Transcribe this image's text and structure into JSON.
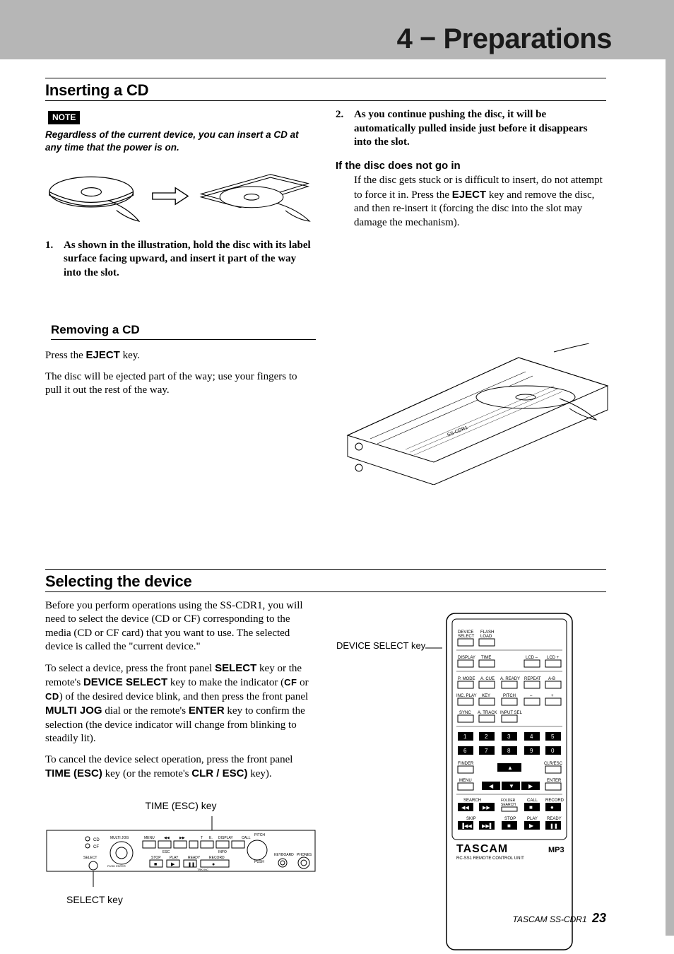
{
  "header": {
    "title": "4 − Preparations"
  },
  "s1": {
    "title": "Inserting a CD",
    "note_label": "NOTE",
    "note_text": "Regardless of the current device, you can insert a CD at any time that the power is on.",
    "steps": [
      "As shown in the illustration, hold the disc with its label surface facing upward, and insert it part of the way into the slot.",
      "As you continue pushing the disc, it will be automatically pulled inside just before it disappears into the slot."
    ],
    "if_title": "If the disc does not go in",
    "if_text_a": "If the disc gets stuck or is difficult to insert, do not attempt to force it in. Press the ",
    "if_key": "EJECT",
    "if_text_b": " key and remove the disc, and then re-insert it (forcing the disc into the slot may damage the mechanism)."
  },
  "s1b": {
    "title": "Removing a CD",
    "p1a": "Press the ",
    "p1_key": "EJECT",
    "p1b": " key.",
    "p2": "The disc will be ejected part of the way; use your fingers to pull it out the rest of the way."
  },
  "s2": {
    "title": "Selecting the device",
    "p1": "Before you perform operations using the SS-CDR1, you will need to select the device (CD or CF) corresponding to the media (CD or CF card) that you want to use. The selected device is called the \"current device.\"",
    "p2a": "To select a device, press the front panel ",
    "key_select": "SELECT",
    "p2b": " key or the remote's ",
    "key_devsel": "DEVICE SELECT",
    "p2c": " key to make the indicator (",
    "cf": "CF",
    "or": " or ",
    "cd": "CD",
    "p2d": ") of the desired device blink, and then press the front panel ",
    "key_mj": "MULTI JOG",
    "p2e": " dial or the remote's ",
    "key_enter": "ENTER",
    "p2f": " key to confirm the selection (the device indicator will change from blinking to steadily lit).",
    "p3a": "To cancel the device select operation, press the front panel ",
    "key_time": "TIME (ESC)",
    "p3b": " key (or the remote's ",
    "key_clr": "CLR / ESC)",
    "p3c": " key).",
    "fig_time_label": "TIME (ESC) key",
    "fig_select_label": "SELECT key",
    "remote_label": "DEVICE SELECT key",
    "remote_rows": {
      "r1": [
        "DEVICE SELECT",
        "FLASH LOAD"
      ],
      "r2": [
        "DISPLAY",
        "TIME",
        "",
        "LCD –",
        "LCD +"
      ],
      "r3": [
        "P. MODE",
        "A. CUE",
        "A. READY",
        "REPEAT",
        "A-B"
      ],
      "r4": [
        "INC. PLAY",
        "KEY",
        "PITCH",
        "–",
        "+"
      ],
      "r5": [
        "SYNC",
        "A. TRACK",
        "INPUT SEL"
      ],
      "num1": [
        "1",
        "2",
        "3",
        "4",
        "5"
      ],
      "num2": [
        "6",
        "7",
        "8",
        "9",
        "0"
      ],
      "r6l": [
        "FINDER",
        "MENU"
      ],
      "r6r": [
        "CLR/ESC",
        "ENTER"
      ],
      "r7": [
        "SEARCH",
        "FOLDER SEARCH",
        "CALL",
        "RECORD"
      ],
      "r8": [
        "SKIP",
        "STOP",
        "PLAY",
        "READY"
      ]
    },
    "brand": "TASCAM",
    "remote_sub": "RC-SS1 REMOTE CONTROL UNIT",
    "mp3": "MP3"
  },
  "footer": {
    "product": "TASCAM  SS-CDR1",
    "page": "23"
  }
}
